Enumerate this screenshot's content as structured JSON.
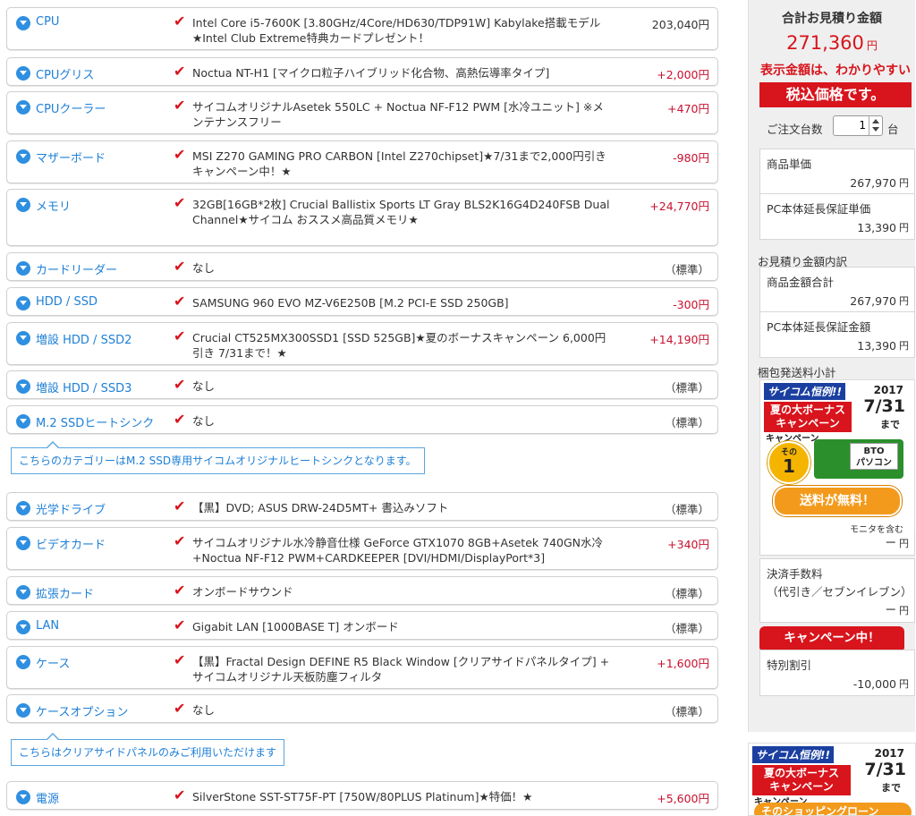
{
  "rows": [
    {
      "category": "CPU",
      "desc": "Intel Core i5-7600K [3.80GHz/4Core/HD630/TDP91W] Kabylake搭載モデル ★Intel Club Extreme特典カードプレゼント！",
      "price": "203,040円",
      "kind": "base"
    },
    {
      "category": "CPUグリス",
      "desc": "Noctua NT-H1 [マイクロ粒子ハイブリッド化合物、高熱伝導率タイプ]",
      "price": "+2,000円",
      "kind": "pos"
    },
    {
      "category": "CPUクーラー",
      "desc": "サイコムオリジナルAsetek 550LC + Noctua NF-F12 PWM [水冷ユニット] ※メンテナンスフリー",
      "price": "+470円",
      "kind": "pos"
    },
    {
      "category": "マザーボード",
      "desc": "MSI Z270 GAMING PRO CARBON [Intel Z270chipset]★7/31まで2,000円引きキャンペーン中！★",
      "price": "-980円",
      "kind": "neg"
    },
    {
      "category": "メモリ",
      "desc": "32GB[16GB*2枚] Crucial Ballistix Sports LT Gray BLS2K16G4D240FSB Dual Channel★サイコム おススメ高品質メモリ★",
      "price": "+24,770円",
      "kind": "pos"
    },
    {
      "category": "カードリーダー",
      "desc": "なし",
      "price": "（標準）",
      "kind": "std"
    },
    {
      "category": "HDD / SSD",
      "desc": "SAMSUNG 960 EVO MZ-V6E250B [M.2 PCI-E SSD 250GB]",
      "price": "-300円",
      "kind": "neg"
    },
    {
      "category": "増設 HDD / SSD2",
      "desc": "Crucial CT525MX300SSD1 [SSD 525GB]★夏のボーナスキャンペーン 6,000円引き 7/31まで！★",
      "price": "+14,190円",
      "kind": "pos"
    },
    {
      "category": "増設 HDD / SSD3",
      "desc": "なし",
      "price": "（標準）",
      "kind": "std"
    },
    {
      "category": "M.2 SSDヒートシンク",
      "desc": "なし",
      "price": "（標準）",
      "kind": "std"
    },
    {
      "category": "光学ドライブ",
      "desc": "【黒】DVD; ASUS DRW-24D5MT+ 書込みソフト",
      "price": "（標準）",
      "kind": "std"
    },
    {
      "category": "ビデオカード",
      "desc": "サイコムオリジナル水冷静音仕様 GeForce GTX1070 8GB+Asetek 740GN水冷+Noctua NF-F12 PWM+CARDKEEPER [DVI/HDMI/DisplayPort*3]",
      "price": "+340円",
      "kind": "pos"
    },
    {
      "category": "拡張カード",
      "desc": "オンボードサウンド",
      "price": "（標準）",
      "kind": "std"
    },
    {
      "category": "LAN",
      "desc": "Gigabit LAN [1000BASE T] オンボード",
      "price": "（標準）",
      "kind": "std"
    },
    {
      "category": "ケース",
      "desc": "【黒】Fractal Design DEFINE R5 Black Window [クリアサイドパネルタイプ] + サイコムオリジナル天板防塵フィルタ",
      "price": "+1,600円",
      "kind": "pos"
    },
    {
      "category": "ケースオプション",
      "desc": "なし",
      "price": "（標準）",
      "kind": "std"
    },
    {
      "category": "電源",
      "desc": "SilverStone SST-ST75F-PT [750W/80PLUS Platinum]★特価！★",
      "price": "+5,600円",
      "kind": "pos"
    }
  ],
  "notes": {
    "heatsink": "こちらのカテゴリーはM.2 SSD専用サイコムオリジナルヒートシンクとなります。",
    "case_option": "こちらはクリアサイドパネルのみご利用いただけます"
  },
  "sidebar": {
    "title": "合計お見積り金額",
    "total": "271,360",
    "yen": "円",
    "notice1": "表示金額は、わかりやすい",
    "notice2": "税込価格です。",
    "qty_label": "ご注文台数",
    "qty_value": "1",
    "qty_unit": "台",
    "unit_price_label": "商品単価",
    "unit_price": "267,970",
    "warranty_unit_label": "PC本体延長保証単価",
    "warranty_unit": "13,390",
    "breakdown_label": "お見積り金額内訳",
    "goods_total_label": "商品金額合計",
    "goods_total": "267,970",
    "warranty_total_label": "PC本体延長保証金額",
    "warranty_total": "13,390",
    "shipping_label": "梱包発送料小計",
    "shipping_value": "ー",
    "fee_label": "決済手数料",
    "fee_label2": "（代引き／セブンイレブン）",
    "fee_value": "ー",
    "campaign_bar": "キャンペーン中！",
    "discount_label": "特別割引",
    "discount_value": "-10,000"
  },
  "banner1": {
    "brand": "サイコム恒例!!",
    "line1": "夏の大ボーナス",
    "line2": "キャンペーン",
    "year": "2017",
    "date": "7/31",
    "made": "まで",
    "campaign": "キャンペーン",
    "sono": "その",
    "one": "1",
    "cargo1": "BTO",
    "cargo2": "パソコン",
    "free": "送料が無料！",
    "monitor": "モニタを含む"
  },
  "banner2": {
    "brand": "サイコム恒例!!",
    "line1": "夏の大ボーナス",
    "line2": "キャンペーン",
    "year": "2017",
    "date": "7/31",
    "made": "まで",
    "campaign": "キャンペーン",
    "tail": "そのショッピングローン"
  }
}
